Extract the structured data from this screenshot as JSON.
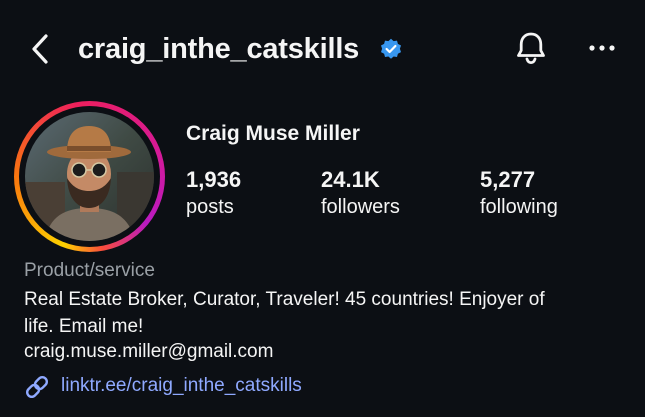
{
  "header": {
    "username": "craig_inthe_catskills",
    "back_icon": "chevron-left-icon",
    "verified_icon": "verified-badge-icon",
    "bell_icon": "bell-icon",
    "more_icon": "more-horizontal-icon",
    "verified_color": "#3897f0"
  },
  "profile": {
    "display_name": "Craig Muse Miller",
    "avatar": "profile-photo",
    "story_ring_colors": [
      "#fdd100",
      "#f9760f",
      "#ee1f5c",
      "#d61a97",
      "#b91ac1"
    ],
    "stats": [
      {
        "value": "1,936",
        "label": "posts"
      },
      {
        "value": "24.1K",
        "label": "followers"
      },
      {
        "value": "5,277",
        "label": "following"
      }
    ],
    "category": "Product/service",
    "bio": "Real Estate Broker, Curator, Traveler! 45 countries! Enjoyer of\nlife. Email me!",
    "email": "craig.muse.miller@gmail.com",
    "link": {
      "icon": "link-icon",
      "text": "linktr.ee/craig_inthe_catskills",
      "color": "#8fa9ff"
    }
  },
  "colors": {
    "background": "#0c0f14",
    "text": "#f5f5f5",
    "secondary_text": "#9aa0a6"
  }
}
